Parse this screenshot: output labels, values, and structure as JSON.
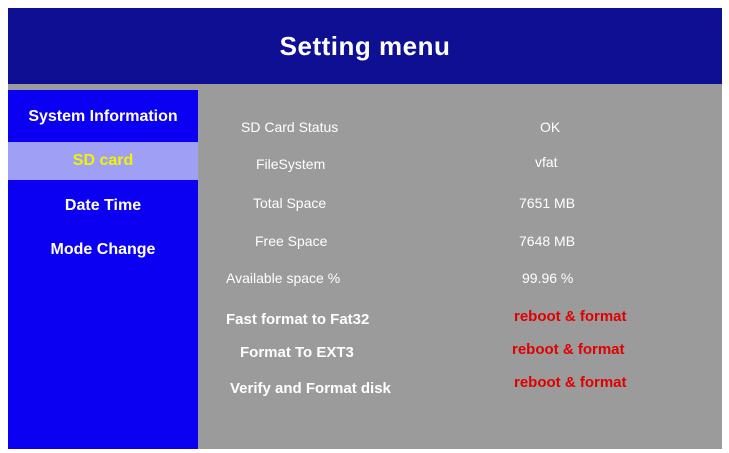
{
  "header": {
    "title": "Setting menu"
  },
  "sidebar": {
    "items": [
      {
        "label": "System Information"
      },
      {
        "label": "SD card"
      },
      {
        "label": "Date Time"
      },
      {
        "label": "Mode Change"
      }
    ],
    "selected_index": 1
  },
  "sd_card": {
    "status_label": "SD Card Status",
    "status_value": "OK",
    "filesystem_label": "FileSystem",
    "filesystem_value": "vfat",
    "total_label": "Total Space",
    "total_value": "7651 MB",
    "free_label": "Free Space",
    "free_value": "7648 MB",
    "available_label": "Available space %",
    "available_value": "99.96 %",
    "actions": [
      {
        "label": "Fast format to Fat32",
        "action": "reboot & format"
      },
      {
        "label": "Format To EXT3",
        "action": "reboot & format"
      },
      {
        "label": "Verify and Format disk",
        "action": "reboot & format"
      }
    ]
  },
  "colors": {
    "header_bg": "#0f0f94",
    "sidebar_bg": "#0b00f2",
    "panel_bg": "#9b9b9b",
    "selected_bg": "#9f9ff6",
    "selected_text": "#f3f300",
    "action_text": "#e00000"
  }
}
